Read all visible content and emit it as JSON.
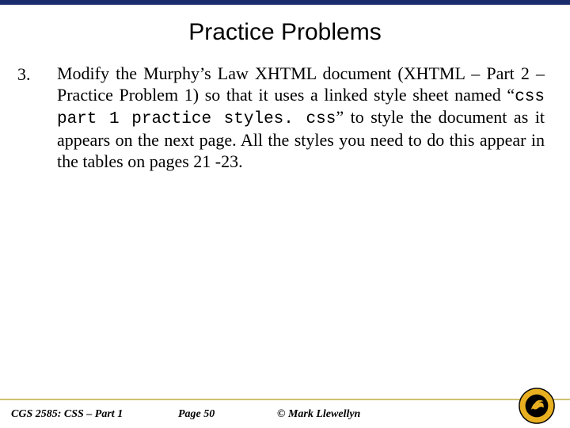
{
  "title": "Practice Problems",
  "item": {
    "number": "3.",
    "pre": "Modify the Murphy’s Law XHTML document (XHTML – Part 2 – Practice Problem 1) so that it uses a linked style sheet named “",
    "code": "css part 1 practice styles. css",
    "post": "” to style the document as it appears on the next page.  All the styles you need to do this appear in the tables on pages 21 -23."
  },
  "footer": {
    "course": "CGS 2585: CSS – Part 1",
    "page": "Page 50",
    "author": "© Mark Llewellyn"
  },
  "logo_name": "ucf-pegasus-logo"
}
